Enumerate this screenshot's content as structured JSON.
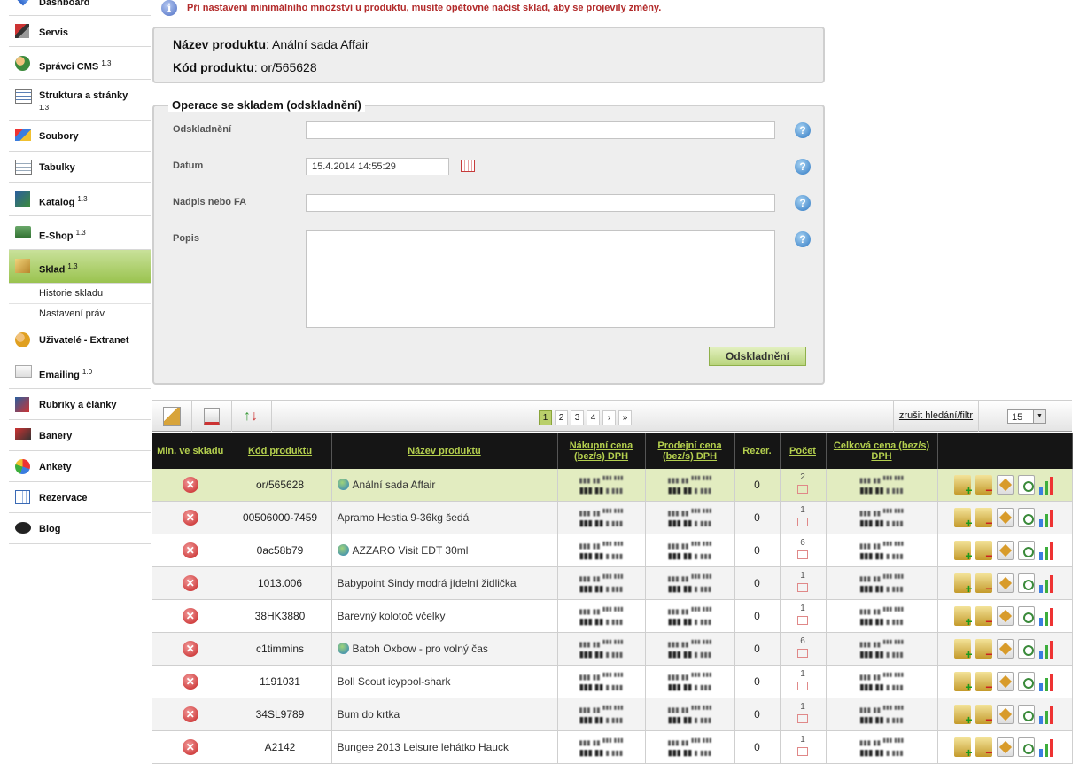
{
  "sidebar": {
    "items": [
      {
        "label": "Dashboard",
        "sup": ""
      },
      {
        "label": "Servis",
        "sup": ""
      },
      {
        "label": "Správci CMS",
        "sup": "1.3"
      },
      {
        "label": "Struktura a stránky",
        "sup": "1.3"
      },
      {
        "label": "Soubory",
        "sup": ""
      },
      {
        "label": "Tabulky",
        "sup": ""
      },
      {
        "label": "Katalog",
        "sup": "1.3"
      },
      {
        "label": "E-Shop",
        "sup": "1.3"
      },
      {
        "label": "Sklad",
        "sup": "1.3"
      },
      {
        "label": "Uživatelé - Extranet",
        "sup": ""
      },
      {
        "label": "Emailing",
        "sup": "1.0"
      },
      {
        "label": "Rubriky a články",
        "sup": ""
      },
      {
        "label": "Banery",
        "sup": ""
      },
      {
        "label": "Ankety",
        "sup": ""
      },
      {
        "label": "Rezervace",
        "sup": ""
      },
      {
        "label": "Blog",
        "sup": ""
      }
    ],
    "subitems": [
      "Historie skladu",
      "Nastavení práv"
    ]
  },
  "info": {
    "text": "Při nastavení minimálního množství u produktu, musíte opětovné načíst sklad, aby se projevily změny."
  },
  "product": {
    "name_label": "Název produktu",
    "name_value": ": Anální sada Affair",
    "code_label": "Kód produktu",
    "code_value": ": or/565628"
  },
  "operation": {
    "legend": "Operace se skladem (odskladnění)",
    "fields": {
      "odskladneni": {
        "label": "Odskladnění",
        "value": ""
      },
      "datum": {
        "label": "Datum",
        "value": "15.4.2014 14:55:29"
      },
      "nadpis": {
        "label": "Nadpis nebo FA",
        "value": ""
      },
      "popis": {
        "label": "Popis",
        "value": ""
      }
    },
    "submit_label": "Odskladnění"
  },
  "toolbar": {
    "pages": [
      "1",
      "2",
      "3",
      "4",
      "›",
      "»"
    ],
    "current_page": "1",
    "clear_filter": "zrušit hledání/filtr",
    "per_page": "15"
  },
  "table": {
    "headers": {
      "min": "Min. ve skladu",
      "code": "Kód produktu",
      "name": "Název produktu",
      "buy": "Nákupní cena (bez/s) DPH",
      "sell": "Prodejní cena (bez/s) DPH",
      "rez": "Rezer.",
      "count": "Počet",
      "total": "Celková cena (bez/s) DPH"
    },
    "rows": [
      {
        "code": "or/565628",
        "name": "Anální sada Affair",
        "rez": "0",
        "count": "2"
      },
      {
        "code": "00506000-7459",
        "name": "Apramo Hestia 9-36kg šedá",
        "rez": "0",
        "count": "1"
      },
      {
        "code": "0ac58b79",
        "name": "AZZARO Visit EDT 30ml",
        "rez": "0",
        "count": "6"
      },
      {
        "code": "1013.006",
        "name": "Babypoint Sindy modrá jídelní židlička",
        "rez": "0",
        "count": "1"
      },
      {
        "code": "38HK3880",
        "name": "Barevný kolotoč včelky",
        "rez": "0",
        "count": "1"
      },
      {
        "code": "c1timmins",
        "name": "Batoh Oxbow - pro volný čas",
        "rez": "0",
        "count": "6"
      },
      {
        "code": "1191031",
        "name": "Boll Scout icypool-shark",
        "rez": "0",
        "count": "1"
      },
      {
        "code": "34SL9789",
        "name": "Bum do krtka",
        "rez": "0",
        "count": "1"
      },
      {
        "code": "A2142",
        "name": "Bungee 2013 Leisure lehátko Hauck",
        "rez": "0",
        "count": "1"
      }
    ]
  }
}
